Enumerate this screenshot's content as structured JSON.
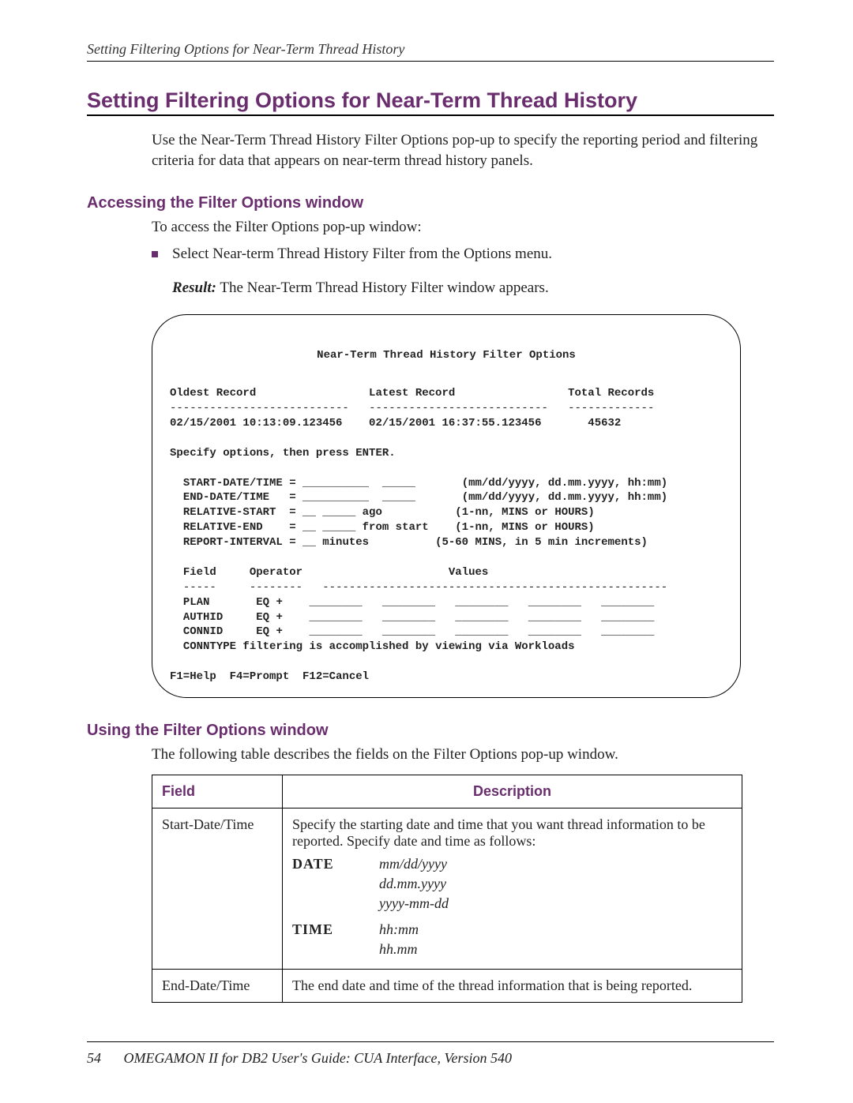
{
  "running_head": "Setting Filtering Options for Near-Term Thread History",
  "title": "Setting Filtering Options for Near-Term Thread History",
  "intro": "Use the Near-Term Thread History Filter Options pop-up to specify the reporting period and filtering criteria for data that appears on near-term thread history panels.",
  "section_access": {
    "heading": "Accessing the Filter Options window",
    "lead": "To access the Filter Options pop-up window:",
    "bullet": "Select Near-term Thread History Filter from the Options menu.",
    "result_label": "Result:",
    "result_text": " The Near-Term Thread History Filter window appears."
  },
  "panel": {
    "title": "Near-Term Thread History Filter Options",
    "col_oldest": "Oldest Record",
    "col_latest": "Latest Record",
    "col_total": "Total Records",
    "dashes1": "---------------------------",
    "dashes2": "---------------------------",
    "dashes3": "-------------",
    "oldest_val": "02/15/2001 10:13:09.123456",
    "latest_val": "02/15/2001 16:37:55.123456",
    "total_val": "45632",
    "specify": "Specify options, then press ENTER.",
    "l_start": "START-DATE/TIME =",
    "l_end": "END-DATE/TIME   =",
    "l_rs": "RELATIVE-START  =",
    "l_re": "RELATIVE-END    =",
    "l_ri": "REPORT-INTERVAL =",
    "ago": "ago",
    "from_start": "from start",
    "minutes": "minutes",
    "h_start": "(mm/dd/yyyy, dd.mm.yyyy, hh:mm)",
    "h_end": "(mm/dd/yyyy, dd.mm.yyyy, hh:mm)",
    "h_rs": "(1-nn, MINS or HOURS)",
    "h_re": "(1-nn, MINS or HOURS)",
    "h_ri": "(5-60 MINS, in 5 min increments)",
    "hdr_field": "Field",
    "hdr_op": "Operator",
    "hdr_vals": "Values",
    "d_field": "-----",
    "d_op": "--------",
    "d_vals": "----------------------------------------------------",
    "plan": "PLAN",
    "authid": "AUTHID",
    "connid": "CONNID",
    "eq": "EQ +",
    "blanks": "________   ________   ________   ________   ________",
    "conntype": "CONNTYPE filtering is accomplished by viewing via Workloads",
    "fkeys": "F1=Help  F4=Prompt  F12=Cancel"
  },
  "section_use": {
    "heading": "Using the Filter Options window",
    "lead": "The following table describes the fields on the Filter Options pop-up window."
  },
  "table": {
    "head_field": "Field",
    "head_desc": "Description",
    "rows": [
      {
        "field": "Start-Date/Time",
        "desc": "Specify the starting date and time that you want thread information to be reported. Specify date and time as follows:",
        "date_label": "DATE",
        "date_vals": [
          "mm/dd/yyyy",
          "dd.mm.yyyy",
          "yyyy-mm-dd"
        ],
        "time_label": "TIME",
        "time_vals": [
          "hh:mm",
          "hh.mm"
        ]
      },
      {
        "field": "End-Date/Time",
        "desc": "The end date and time of the thread information that is being reported."
      }
    ]
  },
  "footer": {
    "page": "54",
    "text": "OMEGAMON II for DB2 User's Guide: CUA Interface, Version 540"
  }
}
